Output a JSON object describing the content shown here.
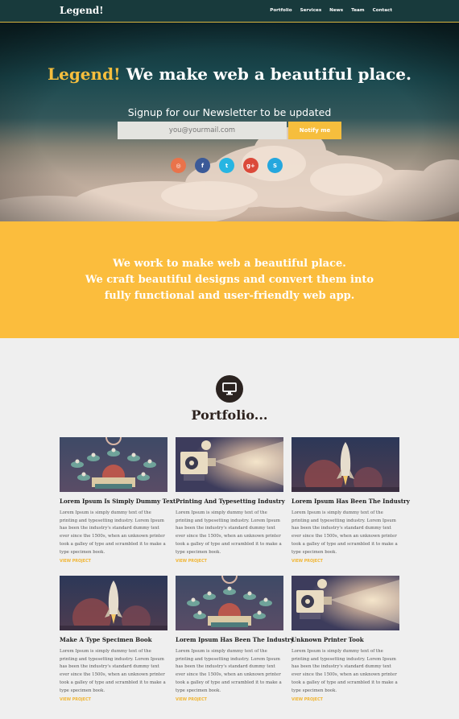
{
  "nav": {
    "brand": "Legend!",
    "items": [
      "Portfolio",
      "Services",
      "News",
      "Team",
      "Contact"
    ]
  },
  "hero": {
    "title_accent": "Legend!",
    "title_rest": " We make web a beautiful place.",
    "subtitle": "Signup for our Newsletter to be updated",
    "email_placeholder": "you@yourmail.com",
    "notify_label": "Notify me"
  },
  "social": [
    {
      "icon": "dribbble-icon",
      "glyph": "◎",
      "color": "#e9734b"
    },
    {
      "icon": "facebook-icon",
      "glyph": "f",
      "color": "#3b5a98"
    },
    {
      "icon": "twitter-icon",
      "glyph": "t",
      "color": "#27b5e2"
    },
    {
      "icon": "google-plus-icon",
      "glyph": "g+",
      "color": "#db4a3a"
    },
    {
      "icon": "skype-icon",
      "glyph": "S",
      "color": "#25a7de"
    }
  ],
  "intro": {
    "line1": "We work to make web a beautiful place.",
    "line2": "We craft beautiful designs and convert them into",
    "line3": "fully functional and user-friendly web app."
  },
  "portfolio": {
    "icon": "monitor-icon",
    "title": "Portfolio...",
    "link_label": "VIEW PROJECT",
    "description": "Lorem Ipsum is simply dummy text of the printing and typesetting industry. Lorem Ipsum has been the industry's standard dummy text ever since the 1500s, when an unknown printer took a galley of type and scrambled it to make a type specimen book.",
    "items": [
      {
        "title": "Lorem Ipsum Is Simply Dummy Text",
        "image": "birds"
      },
      {
        "title": "Printing And Typesetting Industry",
        "image": "projector"
      },
      {
        "title": "Lorem Ipsum Has Been The Industry",
        "image": "rocket"
      },
      {
        "title": "Make A Type Specimen Book",
        "image": "rocket"
      },
      {
        "title": "Lorem Ipsum Has Been The Industry",
        "image": "birds"
      },
      {
        "title": "Unknown Printer Took",
        "image": "projector"
      }
    ]
  }
}
